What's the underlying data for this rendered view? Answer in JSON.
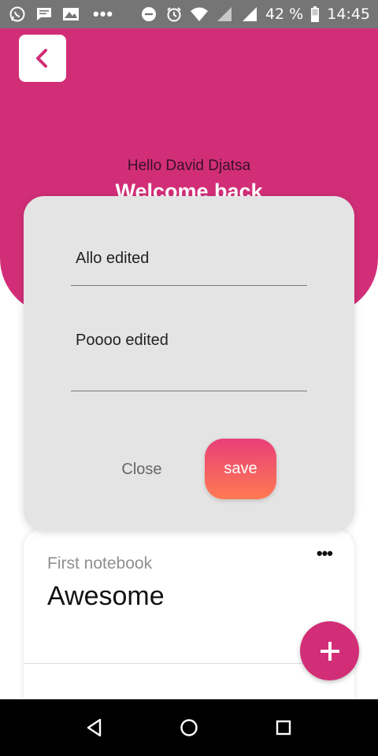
{
  "status_bar": {
    "battery": "42 %",
    "time": "14:45",
    "notification_dots": "•••",
    "icons": [
      "whatsapp-icon",
      "message-icon",
      "gallery-icon",
      "dnd-icon",
      "alarm-icon",
      "wifi-icon",
      "signal-icon",
      "signal-icon",
      "battery-icon"
    ]
  },
  "header": {
    "greeting": "Hello David Djatsa",
    "welcome": "Welcome back",
    "back_icon": "chevron-left-icon"
  },
  "dialog": {
    "title_value": "Allo edited",
    "content_value": "Poooo edited",
    "close_label": "Close",
    "save_label": "save"
  },
  "notebook_card": {
    "notebook_name": "First notebook",
    "note_title": "Awesome",
    "more_label": "•••"
  },
  "fab": {
    "label": "+"
  },
  "colors": {
    "primary": "#d22e78",
    "dialog_bg": "#e4e4e4",
    "save_gradient_top": "#e83f78",
    "save_gradient_bottom": "#ff7a52",
    "status_bar": "#757575"
  }
}
